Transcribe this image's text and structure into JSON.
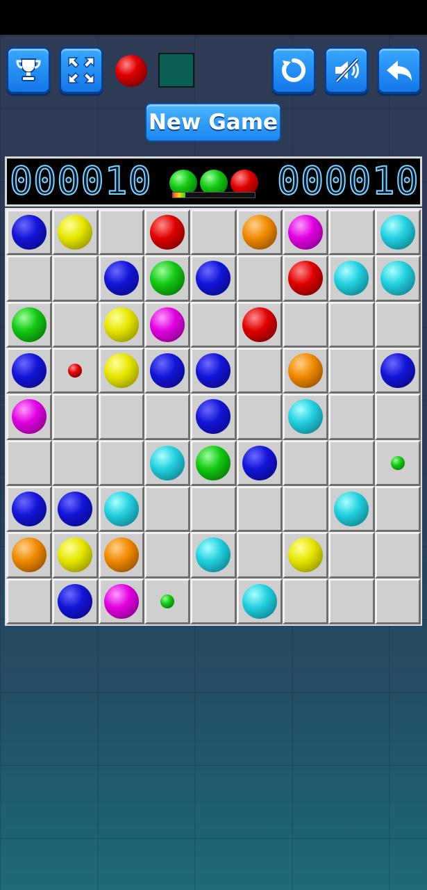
{
  "toolbar": {
    "left_buttons": [
      "trophy-icon",
      "fullscreen-icon"
    ],
    "right_buttons": [
      "restart-icon",
      "sound-muted-icon",
      "back-arrow-icon"
    ],
    "next_color_ball": "red",
    "selected_color_swatch": "#0b5e54",
    "new_game_label": "New Game"
  },
  "scores": {
    "left": "000010",
    "right": "000010"
  },
  "next_balls": [
    "green",
    "green",
    "red"
  ],
  "progress_fraction": 0.15,
  "colors": {
    "blue": [
      "#6a6aff",
      "#1414d8",
      "#060670"
    ],
    "yellow": [
      "#ffff9a",
      "#e6e600",
      "#7a7a00"
    ],
    "red": [
      "#ff8a8a",
      "#e00000",
      "#5a0000"
    ],
    "orange": [
      "#ffd08a",
      "#f08a00",
      "#7a3e00"
    ],
    "magenta": [
      "#ff9aff",
      "#e000e0",
      "#700070"
    ],
    "cyan": [
      "#aaffff",
      "#22d0e0",
      "#0a6a76"
    ],
    "green": [
      "#9aff9a",
      "#12c812",
      "#045e04"
    ]
  },
  "board": [
    [
      "blue",
      "yellow",
      "",
      "red",
      "",
      "orange",
      "magenta",
      "",
      "cyan"
    ],
    [
      "",
      "",
      "blue",
      "green",
      "blue",
      "",
      "red",
      "cyan",
      "cyan"
    ],
    [
      "green",
      "",
      "yellow",
      "magenta",
      "",
      "red",
      "",
      "",
      ""
    ],
    [
      "blue",
      "red:small",
      "yellow",
      "blue",
      "blue",
      "",
      "orange",
      "",
      "blue"
    ],
    [
      "magenta",
      "",
      "",
      "",
      "blue",
      "",
      "cyan",
      "",
      ""
    ],
    [
      "",
      "",
      "",
      "cyan",
      "green",
      "blue",
      "",
      "",
      "green:small"
    ],
    [
      "blue",
      "blue",
      "cyan",
      "",
      "",
      "",
      "",
      "cyan",
      ""
    ],
    [
      "orange",
      "yellow",
      "orange",
      "",
      "cyan",
      "",
      "yellow",
      "",
      ""
    ],
    [
      "",
      "blue",
      "magenta",
      "green:small",
      "",
      "cyan",
      "",
      "",
      ""
    ]
  ]
}
